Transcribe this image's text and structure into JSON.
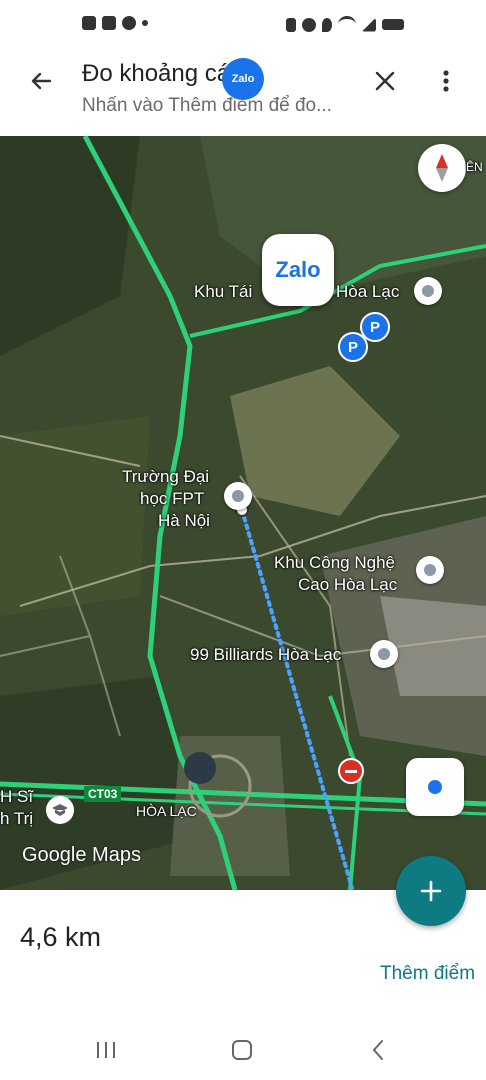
{
  "app_bar": {
    "title": "Đo khoảng cách",
    "subtitle": "Nhấn vào Thêm điểm để đo...",
    "zalo_mini_label": "Zalo"
  },
  "map": {
    "labels": {
      "khu_tai": "Khu Tái",
      "hoa_lac": "Hòa Lạc",
      "fpt_line1": "Trường Đại",
      "fpt_line2": "học FPT",
      "fpt_line3": "Hà Nội",
      "khu_cong_nghe_line1": "Khu Công Nghệ",
      "khu_cong_nghe_line2": "Cao Hòa Lạc",
      "billiards": "99 Billiards Hòa Lạc",
      "hoa_lac_area": "HÒA LẠC",
      "left_partial_1": "H Sĩ",
      "left_partial_2": "h Trị",
      "road_badge": "CT03",
      "corner_partial": "ÊN"
    },
    "zalo_label": "Zalo",
    "attribution": "Google Maps"
  },
  "bottom_sheet": {
    "distance": "4,6 km",
    "add_point": "Thêm điểm"
  },
  "fab_icon": "plus-icon"
}
